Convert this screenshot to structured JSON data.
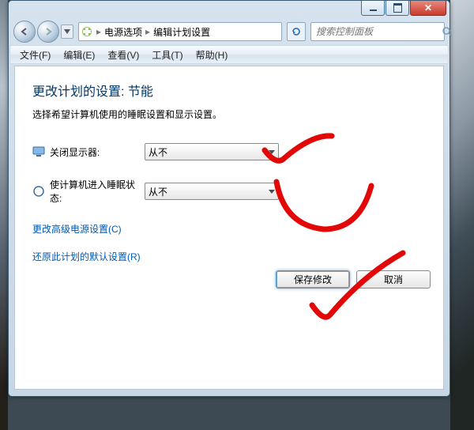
{
  "breadcrumb": [
    "电源选项",
    "编辑计划设置"
  ],
  "search": {
    "placeholder": "搜索控制面板"
  },
  "menu": {
    "file": "文件(F)",
    "edit": "编辑(E)",
    "view": "查看(V)",
    "tools": "工具(T)",
    "help": "帮助(H)"
  },
  "page": {
    "title": "更改计划的设置: 节能",
    "subtitle": "选择希望计算机使用的睡眠设置和显示设置。"
  },
  "settings": {
    "display_off": {
      "label": "关闭显示器:",
      "value": "从不"
    },
    "sleep": {
      "label": "使计算机进入睡眠状态:",
      "value": "从不"
    }
  },
  "links": {
    "advanced": "更改高级电源设置(C)",
    "restore": "还原此计划的默认设置(R)"
  },
  "buttons": {
    "save": "保存修改",
    "cancel": "取消"
  },
  "colors": {
    "accent": "#0059b3",
    "annotation": "#e30808",
    "window_frame": "#c8d7e5"
  }
}
